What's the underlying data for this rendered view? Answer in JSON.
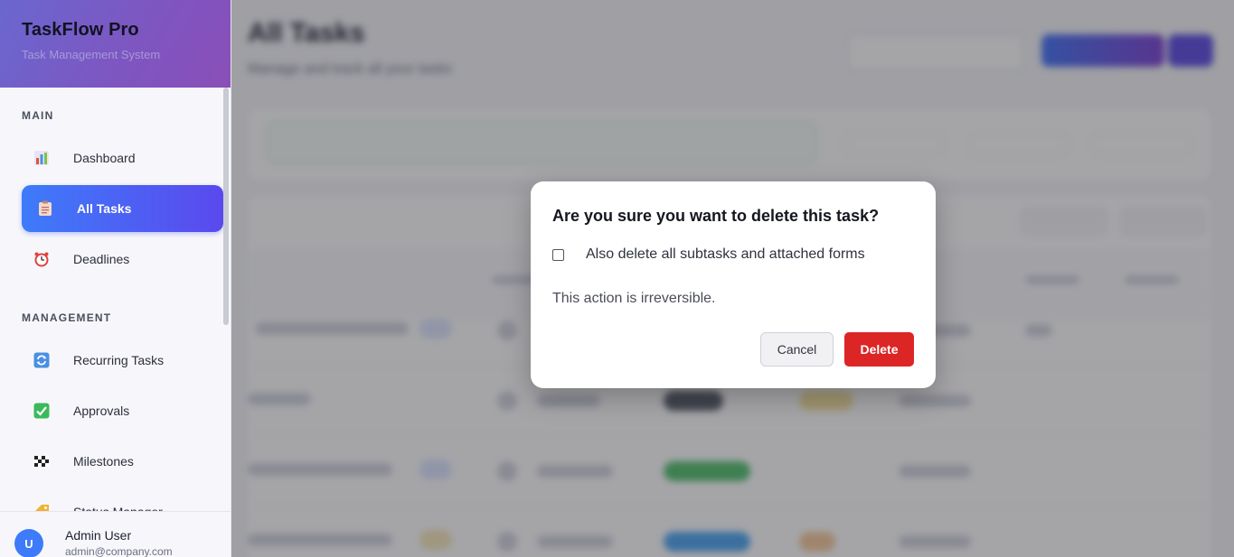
{
  "app": {
    "title": "TaskFlow Pro",
    "subtitle": "Task Management System"
  },
  "sidebar": {
    "sections": [
      {
        "title": "MAIN"
      },
      {
        "title": "MANAGEMENT"
      }
    ],
    "items": [
      {
        "label": "Dashboard",
        "icon": "bar-chart-icon",
        "active": false
      },
      {
        "label": "All Tasks",
        "icon": "clipboard-icon",
        "active": true
      },
      {
        "label": "Deadlines",
        "icon": "alarm-clock-icon",
        "active": false
      },
      {
        "label": "Recurring Tasks",
        "icon": "repeat-icon",
        "active": false
      },
      {
        "label": "Approvals",
        "icon": "check-box-icon",
        "active": false
      },
      {
        "label": "Milestones",
        "icon": "checkered-flag-icon",
        "active": false
      },
      {
        "label": "Status Manager",
        "icon": "tag-icon",
        "active": false
      }
    ],
    "user": {
      "initial": "U",
      "name": "Admin User",
      "email": "admin@company.com"
    }
  },
  "main": {
    "title": "All Tasks",
    "subtitle": "Manage and track all your tasks"
  },
  "dialog": {
    "title": "Are you sure you want to delete this task?",
    "checkbox_label": "Also delete all subtasks and attached forms",
    "checkbox_checked": false,
    "note": "This action is irreversible.",
    "cancel_label": "Cancel",
    "delete_label": "Delete"
  },
  "colors": {
    "accent": "#3e7bfa",
    "brand_gradient_end": "#8a4fb7",
    "danger": "#dc2626"
  }
}
